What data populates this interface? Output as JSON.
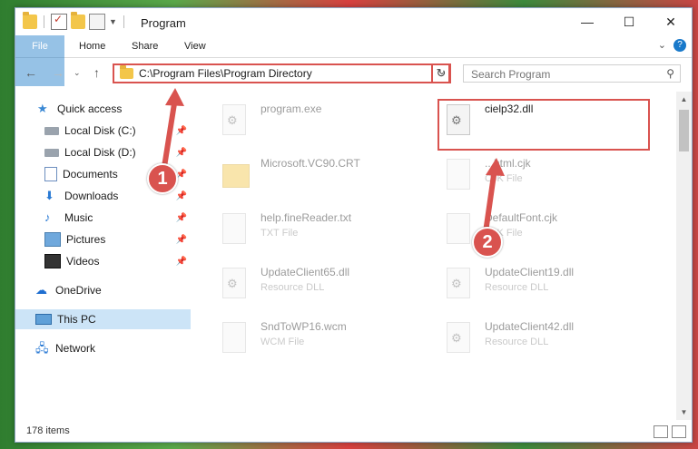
{
  "window": {
    "title": "Program"
  },
  "ribbon": {
    "tabs": [
      "File",
      "Home",
      "Share",
      "View"
    ],
    "help": "?"
  },
  "address": {
    "path": "C:\\Program Files\\Program Directory"
  },
  "search": {
    "placeholder": "Search Program"
  },
  "sidebar": {
    "items": [
      {
        "label": "Quick access",
        "icon": "star-icon",
        "pinned": false
      },
      {
        "label": "Local Disk (C:)",
        "icon": "drive-icon",
        "pinned": true
      },
      {
        "label": "Local Disk (D:)",
        "icon": "drive-icon",
        "pinned": true
      },
      {
        "label": "Documents",
        "icon": "documents-icon",
        "pinned": true
      },
      {
        "label": "Downloads",
        "icon": "download-icon",
        "pinned": true
      },
      {
        "label": "Music",
        "icon": "music-icon",
        "pinned": true
      },
      {
        "label": "Pictures",
        "icon": "pictures-icon",
        "pinned": true
      },
      {
        "label": "Videos",
        "icon": "videos-icon",
        "pinned": true
      },
      {
        "label": "OneDrive",
        "icon": "onedrive-icon",
        "pinned": false
      },
      {
        "label": "This PC",
        "icon": "pc-icon",
        "pinned": false,
        "selected": true
      },
      {
        "label": "Network",
        "icon": "network-icon",
        "pinned": false
      }
    ]
  },
  "files": [
    {
      "name": "program.exe",
      "type": "",
      "icon": "exe-icon"
    },
    {
      "name": "cielp32.dll",
      "type": "",
      "icon": "dll-icon",
      "highlighted": true
    },
    {
      "name": "Microsoft.VC90.CRT",
      "type": "",
      "icon": "folder-icon"
    },
    {
      "name": "...html.cjk",
      "type": "CJK File",
      "icon": "file-icon"
    },
    {
      "name": "help.fineReader.txt",
      "type": "TXT File",
      "icon": "txt-icon"
    },
    {
      "name": "DefaultFont.cjk",
      "type": "CJK File",
      "icon": "file-icon"
    },
    {
      "name": "UpdateClient65.dll",
      "type": "Resource DLL",
      "icon": "dll-icon"
    },
    {
      "name": "UpdateClient19.dll",
      "type": "Resource DLL",
      "icon": "dll-icon"
    },
    {
      "name": "SndToWP16.wcm",
      "type": "WCM File",
      "icon": "file-icon"
    },
    {
      "name": "UpdateClient42.dll",
      "type": "Resource DLL",
      "icon": "dll-icon"
    }
  ],
  "status": {
    "count": "178 items"
  },
  "callouts": {
    "one": "1",
    "two": "2"
  },
  "colors": {
    "accent": "#1979ca",
    "highlight": "#d9534f",
    "selected": "#cce4f7"
  }
}
